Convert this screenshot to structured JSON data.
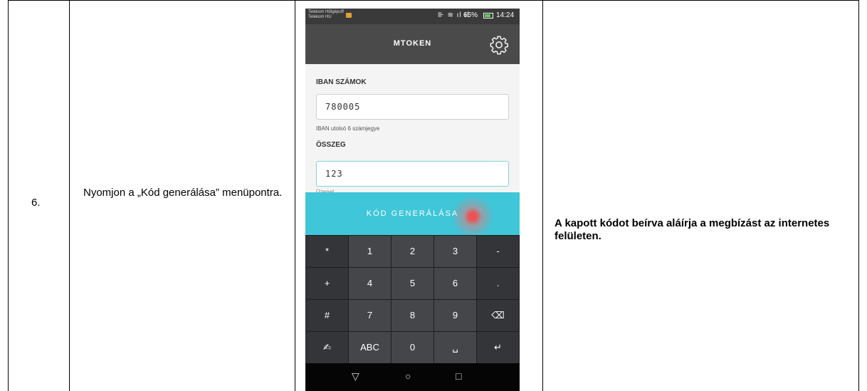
{
  "row": {
    "step_number": "6.",
    "instruction": "Nyomjon a „Kód generálása” menüpontra.",
    "result": "A kapott kódot beírva aláírja a megbízást az internetes felületen."
  },
  "phone": {
    "statusbar": {
      "carrier_line1": "Telekom Hűtgépoff",
      "carrier_line2": "Telekom HU",
      "signal_icons": "⊪ ≋ ıl ıl",
      "battery_percent": "65%",
      "time": "14:24"
    },
    "app": {
      "title": "MTOKEN",
      "settings_icon": "gear-icon"
    },
    "form": {
      "iban_label": "IBAN SZÁMOK",
      "iban_value": "780005",
      "iban_hint": "IBAN utolsó 6 számjegye",
      "amount_label": "ÖSSZEG",
      "amount_value": "123",
      "message_label_partial": "Üzenet"
    },
    "generate_button_label": "KÓD GENERÁLÁSA",
    "keyboard": {
      "rows": [
        [
          "*",
          "1",
          "2",
          "3",
          "-"
        ],
        [
          "+",
          "4",
          "5",
          "6",
          "."
        ],
        [
          "#",
          "7",
          "8",
          "9",
          "⌫"
        ],
        [
          "✍",
          "ABC",
          "0",
          "␣",
          "↵"
        ]
      ]
    },
    "navbar": {
      "back": "▽",
      "home": "○",
      "recents": "□"
    },
    "colors": {
      "accent": "#3fc6d8",
      "appbar": "#4a4a4a",
      "keyboard": "#444649"
    }
  }
}
